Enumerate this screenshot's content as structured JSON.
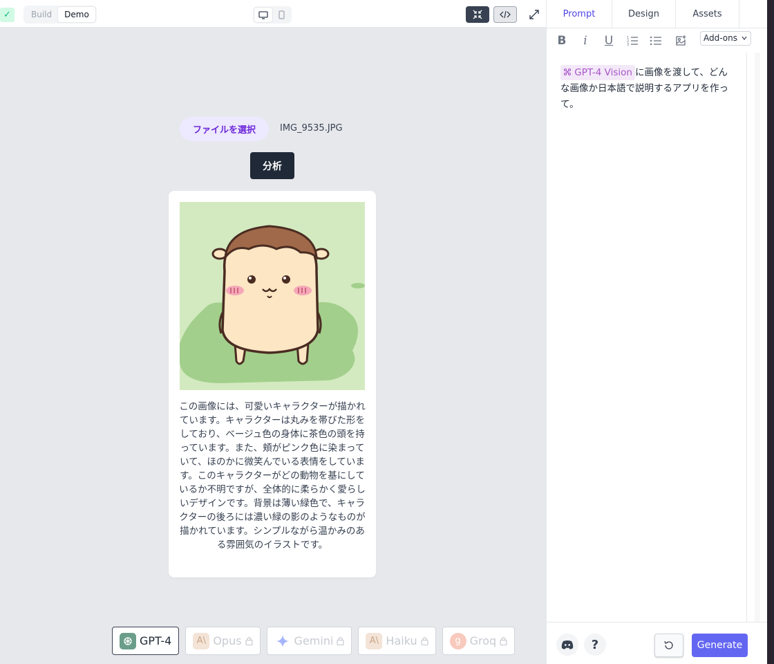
{
  "toolbar": {
    "mode_options": [
      "Build",
      "Demo"
    ],
    "active_mode": "Demo"
  },
  "main": {
    "file_button_label": "ファイルを選択",
    "file_name": "IMG_9535.JPG",
    "analyze_button_label": "分析",
    "description": "この画像には、可愛いキャラクターが描かれています。キャラクターは丸みを帯びた形をしており、ベージュ色の身体に茶色の頭を持っています。また、頬がピンク色に染まっていて、ほのかに微笑んでいる表情をしています。このキャラクターがどの動物を基にしているか不明ですが、全体的に柔らかく愛らしいデザインです。背景は薄い緑色で、キャラクターの後ろには濃い緑の影のようなものが描かれています。シンプルながら温かみのある雰囲気のイラストです。"
  },
  "models": [
    {
      "label": "GPT-4",
      "locked": false,
      "active": true,
      "icon": "openai-icon"
    },
    {
      "label": "Opus",
      "locked": true,
      "active": false,
      "icon": "anthropic-icon"
    },
    {
      "label": "Gemini",
      "locked": true,
      "active": false,
      "icon": "gemini-icon"
    },
    {
      "label": "Haiku",
      "locked": true,
      "active": false,
      "icon": "anthropic-icon"
    },
    {
      "label": "Groq",
      "locked": true,
      "active": false,
      "icon": "groq-icon"
    }
  ],
  "panel": {
    "tabs": [
      "Prompt",
      "Design",
      "Assets"
    ],
    "active_tab": "Prompt",
    "addons_label": "Add-ons",
    "prompt_chip": "GPT-4 Vision",
    "prompt_text": "に画像を渡して、どんな画像か日本語で説明するアプリを作って。",
    "generate_label": "Generate"
  },
  "colors": {
    "accent": "#6366f1",
    "active_tab": "#4f46e5",
    "file_button_bg": "#ede9fe",
    "file_button_text": "#6d28d9",
    "chip_text": "#a855c7"
  }
}
